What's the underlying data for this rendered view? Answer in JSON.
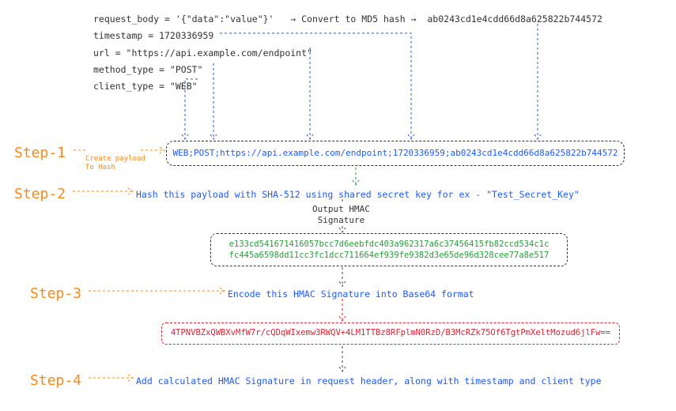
{
  "code": {
    "line1_lhs": "request_body = '{\"data\":\"value\"}'",
    "line1_mid": "→ Convert to MD5 hash →",
    "line1_rhs": "ab0243cd1e4cdd66d8a625822b744572",
    "line2": "timestamp = 1720336959",
    "line3": "url = \"https://api.example.com/endpoint\"",
    "line4": "method_type = \"POST\"",
    "line5": "client_type = \"WEB\""
  },
  "steps": {
    "step1": "Step-1",
    "step1_sub": "Create payload\nTo Hash",
    "step2": "Step-2",
    "step2_text": "Hash this payload with SHA-512 using shared secret key for ex - \"Test_Secret_Key\"",
    "step3": "Step-3",
    "step3_text": "Encode this HMAC Signature into Base64 format",
    "step4": "Step-4",
    "step4_text": "Add calculated HMAC Signature in request header, along with timestamp and client type"
  },
  "payload_box": "WEB;POST;https://api.example.com/endpoint;1720336959;ab0243cd1e4cdd66d8a625822b744572",
  "hmac_output_label": "Output HMAC\nSignature",
  "hmac_hex": {
    "l1": "e133cd541671416057bcc7d6eebfdc403a962317a6c37456415fb82ccd534c1c",
    "l2": "fc445a6598dd11cc3fc1dcc711664ef939fe9382d3e65de96d328cee77a8e517"
  },
  "b64_signature": "4TPNVBZxQWBXvMfW7r/cQDqWIxemw3RWQV+4LM1TTBz8RFplmN0RzD/B3McRZk75Of6TgtPmXeltMozud6jlFw=="
}
